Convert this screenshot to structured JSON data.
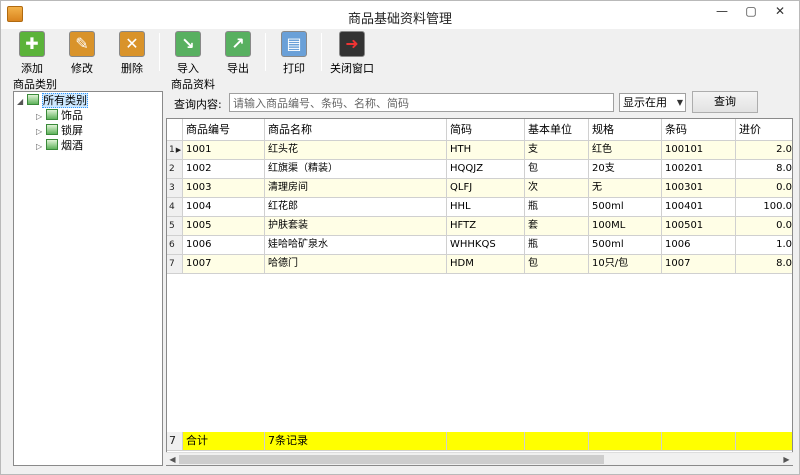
{
  "window": {
    "title": "商品基础资料管理",
    "min": "—",
    "max": "▢",
    "close": "✕"
  },
  "toolbar": {
    "add": "添加",
    "edit": "修改",
    "delete": "删除",
    "import": "导入",
    "export": "导出",
    "print": "打印",
    "close_window": "关闭窗口"
  },
  "colors": {
    "add": "#5bb33a",
    "edit": "#d9932a",
    "delete": "#d9932a",
    "import": "#58b060",
    "export": "#58b060",
    "print": "#6aa0d8",
    "close_window": "#333333",
    "row_alt": "#fffee6",
    "footer": "#ffff00"
  },
  "category": {
    "header": "商品类别",
    "root": "所有类别",
    "children": [
      "饰品",
      "锁屏",
      "烟酒"
    ]
  },
  "goods": {
    "header": "商品资料",
    "query_label": "查询内容:",
    "query_placeholder": "请输入商品编号、条码、名称、简码",
    "filter_value": "显示在用",
    "query_button": "查询"
  },
  "table": {
    "columns": [
      "商品编号",
      "商品名称",
      "简码",
      "基本单位",
      "规格",
      "条码",
      "进价"
    ],
    "rows": [
      {
        "no": "1",
        "code": "1001",
        "name": "红头花",
        "abbr": "HTH",
        "unit": "支",
        "spec": "红色",
        "barcode": "100101",
        "price": "2.0"
      },
      {
        "no": "2",
        "code": "1002",
        "name": "红旗渠（精装）",
        "abbr": "HQQJZ",
        "unit": "包",
        "spec": "20支",
        "barcode": "100201",
        "price": "8.0"
      },
      {
        "no": "3",
        "code": "1003",
        "name": "清理房间",
        "abbr": "QLFJ",
        "unit": "次",
        "spec": "无",
        "barcode": "100301",
        "price": "0.0"
      },
      {
        "no": "4",
        "code": "1004",
        "name": "红花郎",
        "abbr": "HHL",
        "unit": "瓶",
        "spec": "500ml",
        "barcode": "100401",
        "price": "100.0"
      },
      {
        "no": "5",
        "code": "1005",
        "name": "护肤套装",
        "abbr": "HFTZ",
        "unit": "套",
        "spec": "100ML",
        "barcode": "100501",
        "price": "0.0"
      },
      {
        "no": "6",
        "code": "1006",
        "name": "娃哈哈矿泉水",
        "abbr": "WHHKQS",
        "unit": "瓶",
        "spec": "500ml",
        "barcode": "1006",
        "price": "1.0"
      },
      {
        "no": "7",
        "code": "1007",
        "name": "哈德门",
        "abbr": "HDM",
        "unit": "包",
        "spec": "10只/包",
        "barcode": "1007",
        "price": "8.0"
      }
    ],
    "footer": {
      "no": "7",
      "label": "合计",
      "count": "7条记录"
    }
  }
}
